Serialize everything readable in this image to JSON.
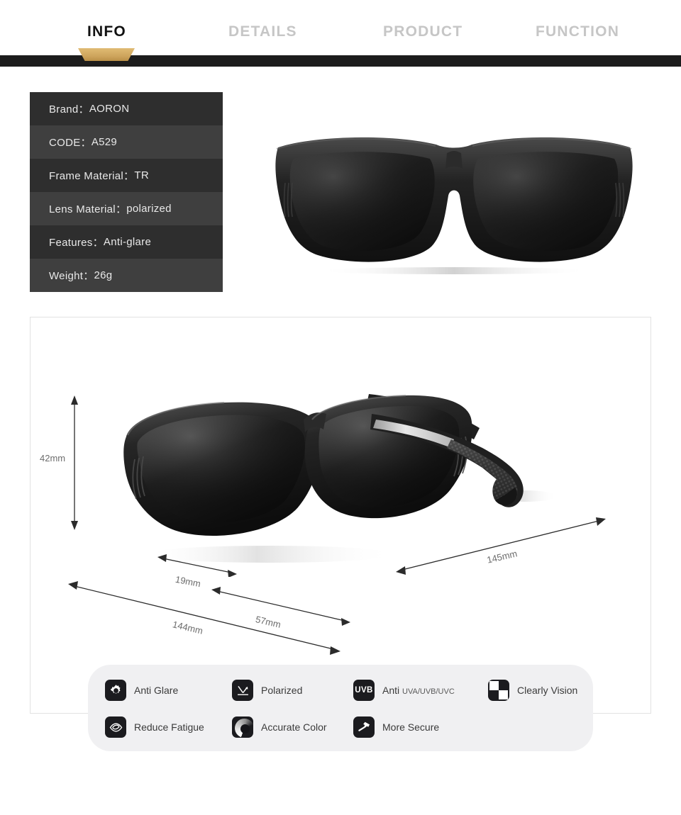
{
  "nav": {
    "tabs": [
      {
        "label": "INFO",
        "active": true
      },
      {
        "label": "DETAILS",
        "active": false
      },
      {
        "label": "PRODUCT",
        "active": false
      },
      {
        "label": "FUNCTION",
        "active": false
      }
    ],
    "accent_color": "#cda35b",
    "band_color": "#1c1c1c"
  },
  "info_table": {
    "rows": [
      {
        "key": "Brand：",
        "value": "AORON"
      },
      {
        "key": "CODE：",
        "value": "A529"
      },
      {
        "key": "Frame Material：",
        "value": "TR"
      },
      {
        "key": "Lens Material：",
        "value": "polarized"
      },
      {
        "key": "Features：",
        "value": "Anti-glare"
      },
      {
        "key": "Weight：",
        "value": "26g"
      }
    ],
    "row_color_odd": "#2e2e2e",
    "row_color_even": "#3f3f3f",
    "text_color": "#e9e9e9"
  },
  "product_image": {
    "top_view": "sunglasses-front-view",
    "angled_view": "sunglasses-angled-view"
  },
  "dimensions": {
    "height": "42mm",
    "bridge": "19mm",
    "lens_width": "57mm",
    "frame_width": "144mm",
    "temple_length": "145mm",
    "label_color": "#6d6d6d"
  },
  "features": {
    "panel_color": "#f0f0f2",
    "icon_bg": "#1b1b1f",
    "items": [
      {
        "icon": "sun-gear-icon",
        "label": "Anti Glare",
        "sub": ""
      },
      {
        "icon": "polarized-ray-icon",
        "label": "Polarized",
        "sub": ""
      },
      {
        "icon": "uvb-badge-icon",
        "label": "Anti ",
        "sub": "UVA/UVB/UVC"
      },
      {
        "icon": "checkerboard-icon",
        "label": "Clearly Vision",
        "sub": ""
      },
      {
        "icon": "eye-icon",
        "label": "Reduce Fatigue",
        "sub": ""
      },
      {
        "icon": "color-wheel-icon",
        "label": "Accurate Color",
        "sub": ""
      },
      {
        "icon": "hammer-icon",
        "label": "More Secure",
        "sub": ""
      }
    ]
  }
}
